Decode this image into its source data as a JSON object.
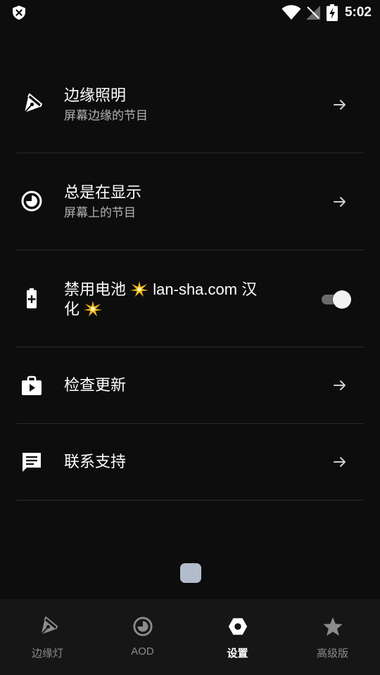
{
  "status_bar": {
    "time": "5:02"
  },
  "settings": {
    "items": [
      {
        "title": "边缘照明",
        "subtitle": "屏幕边缘的节目",
        "icon": "pen-nib-icon",
        "control": "arrow"
      },
      {
        "title": "总是在显示",
        "subtitle": "屏幕上的节目",
        "icon": "clock-icon",
        "control": "arrow"
      },
      {
        "title_part1": "禁用电池",
        "title_part2": "lan-sha.com 汉",
        "title_part3": "化",
        "icon": "battery-plus-icon",
        "control": "toggle",
        "toggle_on": true
      },
      {
        "title": "检查更新",
        "icon": "store-play-icon",
        "control": "arrow"
      },
      {
        "title": "联系支持",
        "icon": "chat-bubble-icon",
        "control": "arrow"
      }
    ]
  },
  "bottom_nav": {
    "items": [
      {
        "label": "边缘灯",
        "icon": "pen-nib-icon",
        "active": false
      },
      {
        "label": "AOD",
        "icon": "clock-icon",
        "active": false
      },
      {
        "label": "设置",
        "icon": "gear-hex-icon",
        "active": true
      },
      {
        "label": "高级版",
        "icon": "star-icon",
        "active": false
      }
    ]
  },
  "colors": {
    "background": "#0d0d0d",
    "nav_background": "#161616",
    "divider": "#2a2a2a",
    "subtitle": "#b3b3b3",
    "inactive_nav": "#8c8c8c",
    "spark": "#f5b820"
  }
}
